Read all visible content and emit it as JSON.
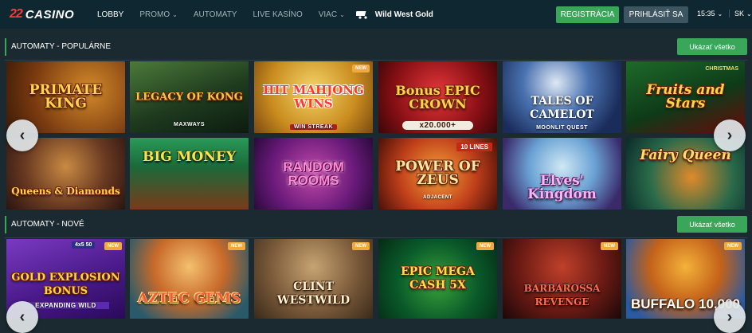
{
  "header": {
    "logo_mark": "22",
    "logo_text": "CASINO",
    "nav": [
      {
        "label": "LOBBY",
        "chevron": false
      },
      {
        "label": "PROMO",
        "chevron": true
      },
      {
        "label": "AUTOMATY",
        "chevron": false
      },
      {
        "label": "LIVE KASÍNO",
        "chevron": false
      },
      {
        "label": "VIAC",
        "chevron": true
      }
    ],
    "featured": "Wild West Gold",
    "register": "REGISTRÁCIA",
    "login": "PRIHLÁSIŤ SA",
    "time": "15:35",
    "language": "SK"
  },
  "sections": [
    {
      "title": "AUTOMATY - POPULÁRNE",
      "show_all": "Ukázať všetko",
      "games": [
        {
          "name": "PRIMATE KING",
          "sub": "",
          "badge": ""
        },
        {
          "name": "LEGACY OF KONG",
          "sub": "MAXWAYS",
          "badge": ""
        },
        {
          "name": "HIT MAHJONG WINS",
          "sub": "WIN STREAK",
          "badge": "NEW"
        },
        {
          "name": "Bonus EPIC CROWN",
          "sub": "x20.000+",
          "badge": ""
        },
        {
          "name": "TALES OF CAMELOT",
          "sub": "MOONLIT QUEST",
          "badge": ""
        },
        {
          "name": "Fruits and Stars",
          "sub": "",
          "badge": "CHRISTMAS"
        },
        {
          "name": "Queens & Diamonds",
          "sub": "",
          "badge": ""
        },
        {
          "name": "BIG MONEY",
          "sub": "",
          "badge": ""
        },
        {
          "name": "RANDOM ROOMS",
          "sub": "",
          "badge": ""
        },
        {
          "name": "POWER OF ZEUS",
          "sub": "ADJACENT",
          "badge": "10 LINES"
        },
        {
          "name": "Elves' Kingdom",
          "sub": "",
          "badge": ""
        },
        {
          "name": "Fairy Queen",
          "sub": "",
          "badge": ""
        }
      ]
    },
    {
      "title": "AUTOMATY - NOVÉ",
      "show_all": "Ukázať všetko",
      "games": [
        {
          "name": "GOLD EXPLOSION BONUS",
          "sub": "EXPANDING WILD",
          "badge": "NEW",
          "extra": "4x5 50"
        },
        {
          "name": "AZTEC GEMS",
          "sub": "",
          "badge": "NEW"
        },
        {
          "name": "CLINT WESTWILD",
          "sub": "",
          "badge": "NEW"
        },
        {
          "name": "EPIC MEGA CASH 5X",
          "sub": "",
          "badge": "NEW"
        },
        {
          "name": "BARBAROSSA REVENGE",
          "sub": "",
          "badge": "NEW"
        },
        {
          "name": "BUFFALO 10,000",
          "sub": "",
          "badge": "NEW"
        }
      ]
    }
  ],
  "colors": {
    "accent": "#3aa65a",
    "header_bg": "#0f2730",
    "page_bg": "#1b2a30",
    "badge_new": "#f2a93b"
  },
  "icons": {
    "prev": "chevron-left-icon",
    "next": "chevron-right-icon",
    "dropdown": "chevron-down-icon",
    "featured": "wagon-icon"
  }
}
